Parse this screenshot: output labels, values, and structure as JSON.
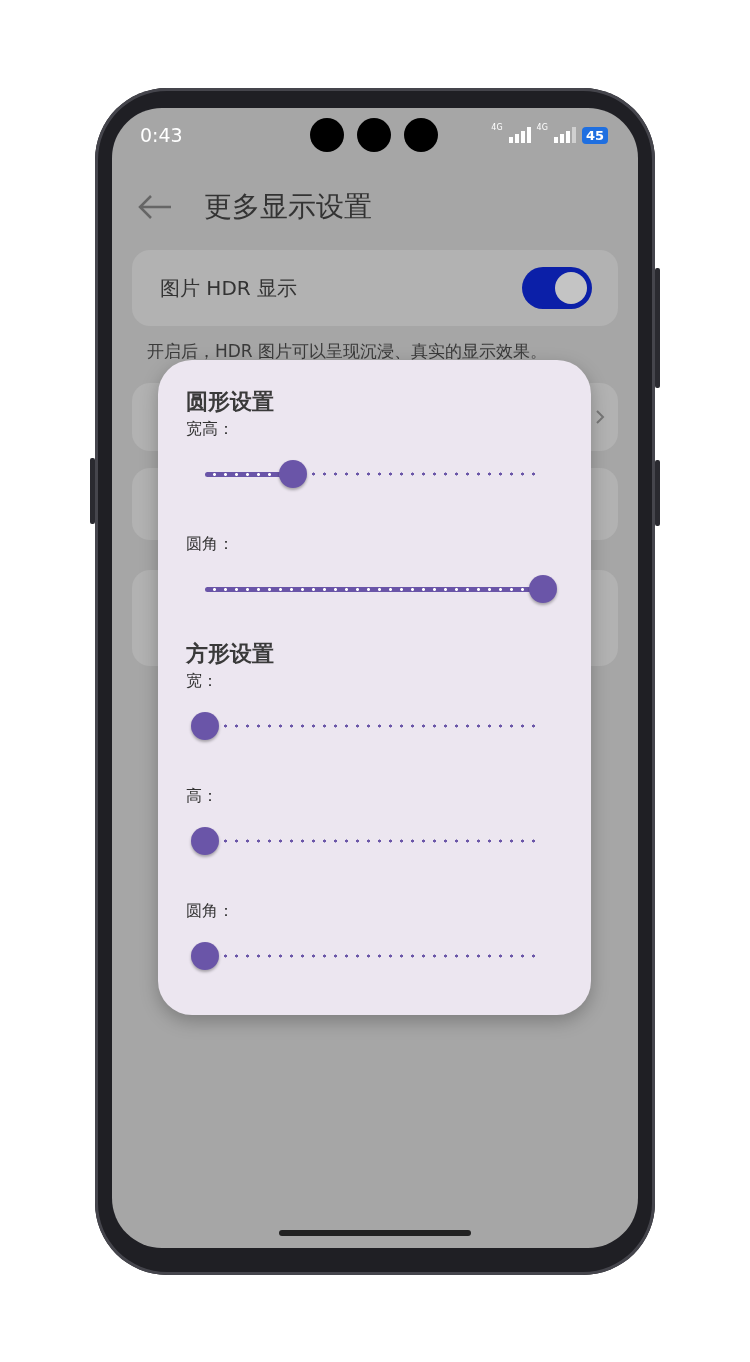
{
  "status_bar": {
    "time": "0:43",
    "network_1": "4G",
    "network_2": "4G",
    "battery": "45"
  },
  "header": {
    "title": "更多显示设置"
  },
  "hdr_setting": {
    "label": "图片 HDR 显示",
    "on": true
  },
  "hdr_description": "开启后，HDR 图片可以呈现沉浸、真实的显示效果。",
  "dialog": {
    "sections": [
      {
        "title": "圆形设置",
        "sliders": [
          {
            "label": "宽高：",
            "level": 0.26
          },
          {
            "label": "圆角：",
            "level": 1
          }
        ]
      },
      {
        "title": "方形设置",
        "sliders": [
          {
            "label": "宽：",
            "level": 0
          },
          {
            "label": "高：",
            "level": 0
          },
          {
            "label": "圆角：",
            "level": 0
          }
        ]
      }
    ]
  }
}
